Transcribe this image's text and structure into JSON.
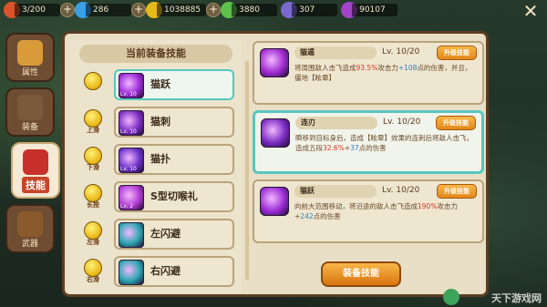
{
  "hud": {
    "resources": [
      {
        "icon": "flame-icon",
        "value": "3/200",
        "color": "#d9542a"
      },
      {
        "icon": "blue-gem-icon",
        "value": "286",
        "color": "#3aa0e6"
      },
      {
        "icon": "gold-coin-icon",
        "value": "1038885",
        "color": "#e6b818"
      },
      {
        "icon": "green-leaf-icon",
        "value": "3880",
        "color": "#5cc24a"
      },
      {
        "icon": "badge-icon",
        "value": "307",
        "color": "#7a6ad0"
      },
      {
        "icon": "purple-star-icon",
        "value": "90107",
        "color": "#a044c8"
      }
    ],
    "close": "✕"
  },
  "side_tabs": [
    {
      "label": "属性",
      "icon": "chick-icon",
      "active": false
    },
    {
      "label": "装备",
      "icon": "helmet-icon",
      "active": false
    },
    {
      "label": "技能",
      "icon": "skill-book-icon",
      "active": true
    },
    {
      "label": "武器",
      "icon": "weapon-icon",
      "active": false
    }
  ],
  "left_title": "当前装备技能",
  "slots": [
    {
      "key": "",
      "name": "猫跃",
      "lv": "Lv. 10",
      "color": "#9b2cd6",
      "selected": true
    },
    {
      "key": "上滑",
      "name": "猫刺",
      "lv": "Lv. 10",
      "color": "#7a2cc2",
      "selected": false
    },
    {
      "key": "下滑",
      "name": "猫扑",
      "lv": "Lv. 10",
      "color": "#6a30c8",
      "selected": false
    },
    {
      "key": "长按",
      "name": "S型切喉礼",
      "lv": "Lv. 2",
      "color": "#b03ad0",
      "selected": false
    },
    {
      "key": "左滑",
      "name": "左闪避",
      "lv": "",
      "color": "#2aa6b0",
      "selected": false
    },
    {
      "key": "右滑",
      "name": "右闪避",
      "lv": "",
      "color": "#2aa6b0",
      "selected": false
    }
  ],
  "details": [
    {
      "name": "猫遁",
      "lv": "Lv. 10/20",
      "button": "升级技能",
      "color": "#a02ad0",
      "selected": false,
      "desc_pre": "将周围敌人击飞造成",
      "desc_hl": "93.5%",
      "desc_post": "攻击力",
      "desc_hl2": "+108",
      "desc_end": "点的伤害，并且，僵地【眩晕】"
    },
    {
      "name": "连刃",
      "lv": "Lv. 10/20",
      "button": "升级技能",
      "color": "#7a2cc2",
      "selected": true,
      "desc_pre": "瞬移到目标身后，造成【眩晕】效果的连刺后将敌人击飞，造成五段",
      "desc_hl": "32.6%",
      "desc_post": "+",
      "desc_hl2": "37",
      "desc_end": "点的伤害"
    },
    {
      "name": "猫跃",
      "lv": "Lv. 10/20",
      "button": "升级技能",
      "color": "#9b2cd6",
      "selected": false,
      "desc_pre": "向前大范围移动，将沿途的敌人击飞造成",
      "desc_hl": "190%",
      "desc_post": "攻击力+",
      "desc_hl2": "242",
      "desc_end": "点的伤害"
    }
  ],
  "equip_button": "装备技能",
  "watermark": "天下游戏网"
}
